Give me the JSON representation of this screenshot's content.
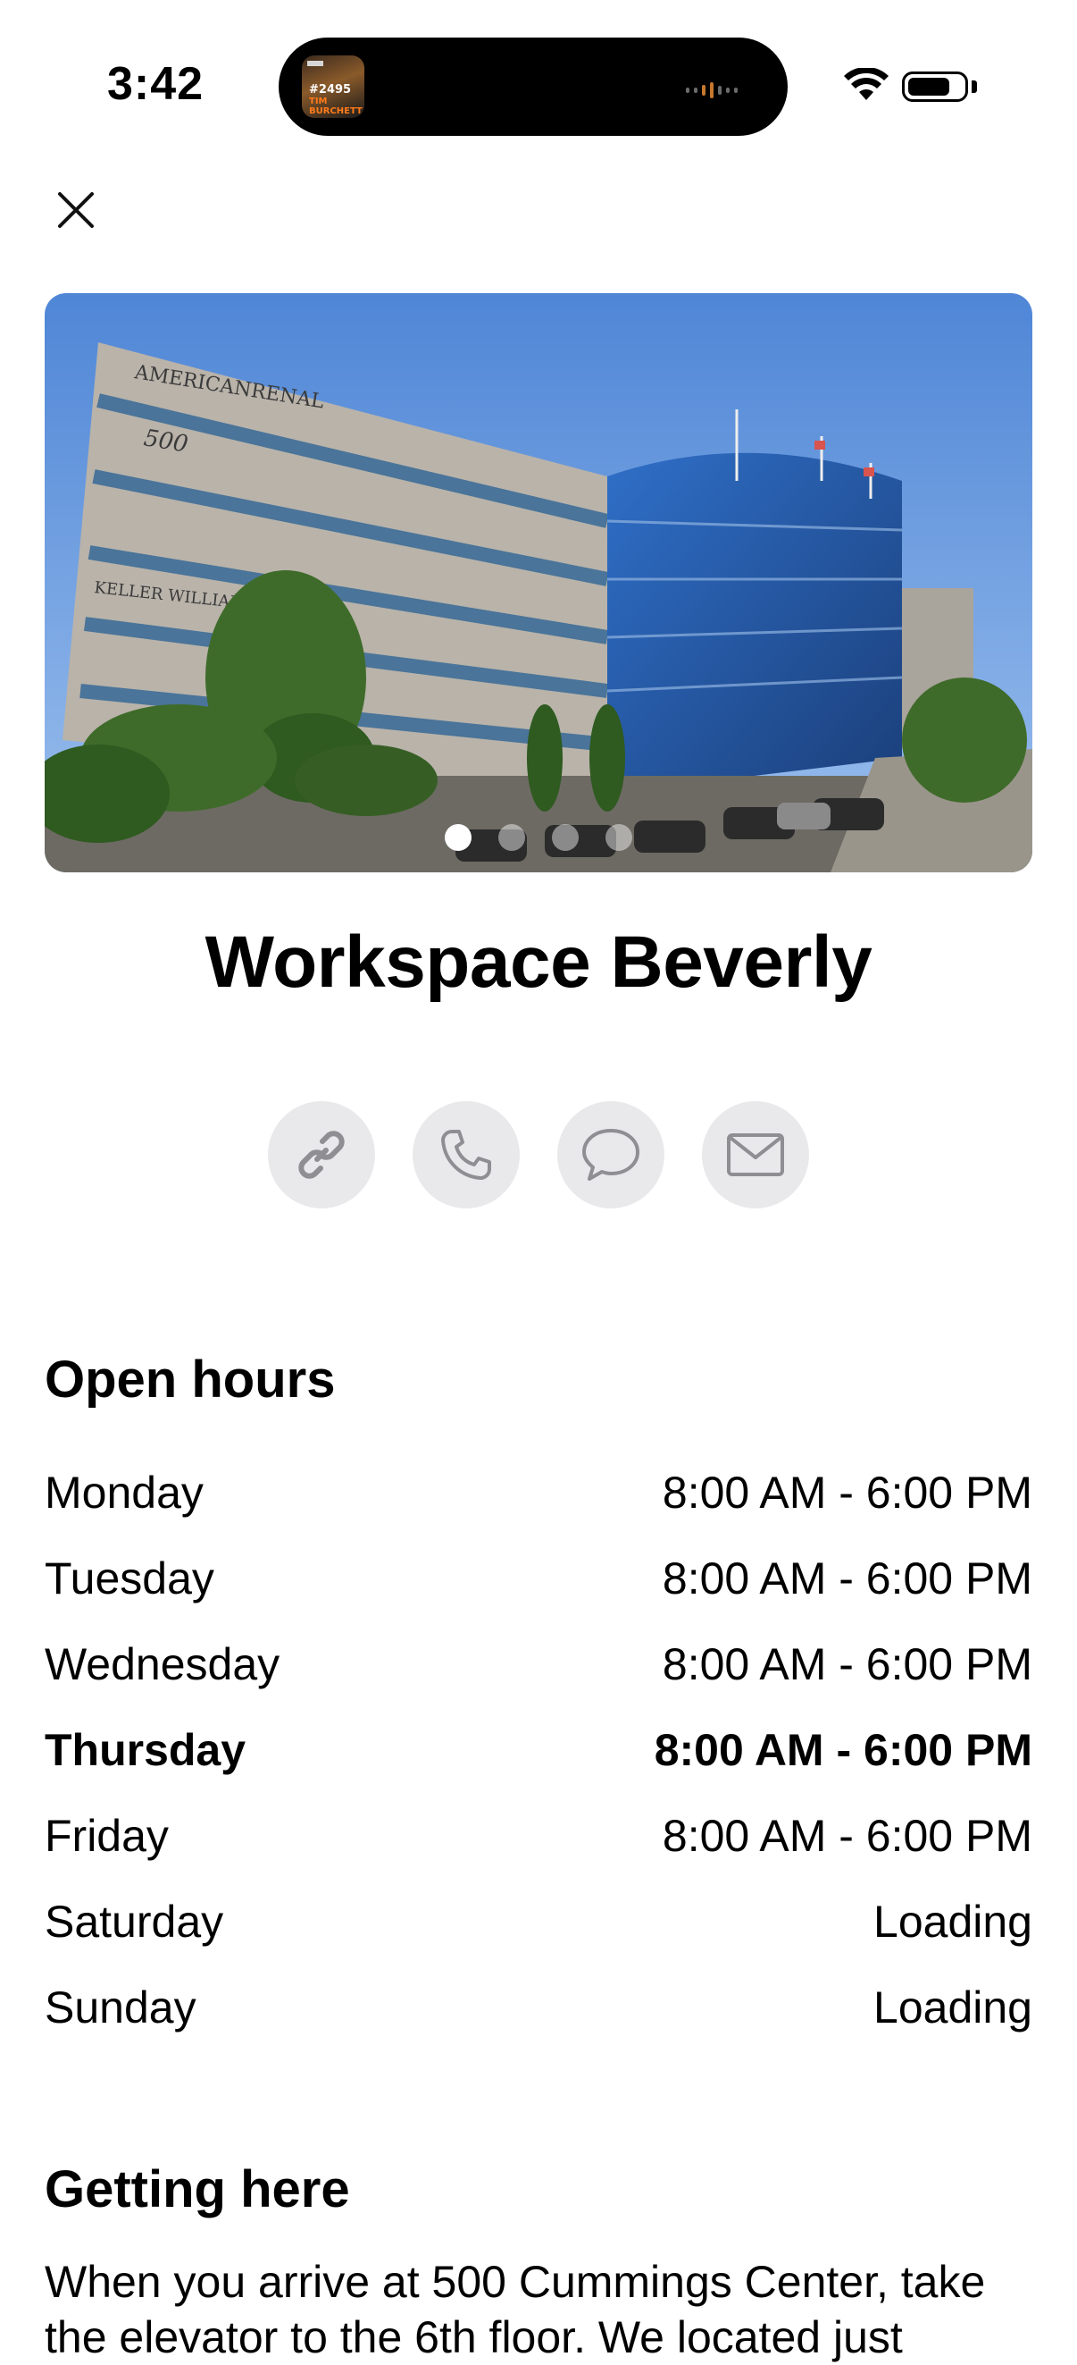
{
  "status_bar": {
    "time": "3:42"
  },
  "dynamic_island": {
    "thumb_episode": "#2495",
    "thumb_name": "TIM BURCHETT"
  },
  "header": {
    "close_icon": "close-icon"
  },
  "place": {
    "name": "Workspace Beverly"
  },
  "carousel": {
    "current_index": 1,
    "count": 4
  },
  "actions": [
    {
      "name": "link",
      "icon": "link-icon"
    },
    {
      "name": "phone",
      "icon": "phone-icon"
    },
    {
      "name": "message",
      "icon": "message-icon"
    },
    {
      "name": "email",
      "icon": "mail-icon"
    }
  ],
  "open_hours": {
    "title": "Open hours",
    "days": [
      {
        "day": "Monday",
        "hours": "8:00 AM - 6:00 PM"
      },
      {
        "day": "Tuesday",
        "hours": "8:00 AM - 6:00 PM"
      },
      {
        "day": "Wednesday",
        "hours": "8:00 AM - 6:00 PM"
      },
      {
        "day": "Thursday",
        "hours": "8:00 AM - 6:00 PM"
      },
      {
        "day": "Friday",
        "hours": "8:00 AM - 6:00 PM"
      },
      {
        "day": "Saturday",
        "hours": "Loading"
      },
      {
        "day": "Sunday",
        "hours": "Loading"
      }
    ]
  },
  "getting_here": {
    "title": "Getting here",
    "text": "When you arrive at 500 Cummings Center, take the elevator to the 6th floor. We located just"
  },
  "colors": {
    "action_bg": "#e9e9eb",
    "icon_gray": "#8e8e93",
    "sky": "#5b8fd8"
  }
}
